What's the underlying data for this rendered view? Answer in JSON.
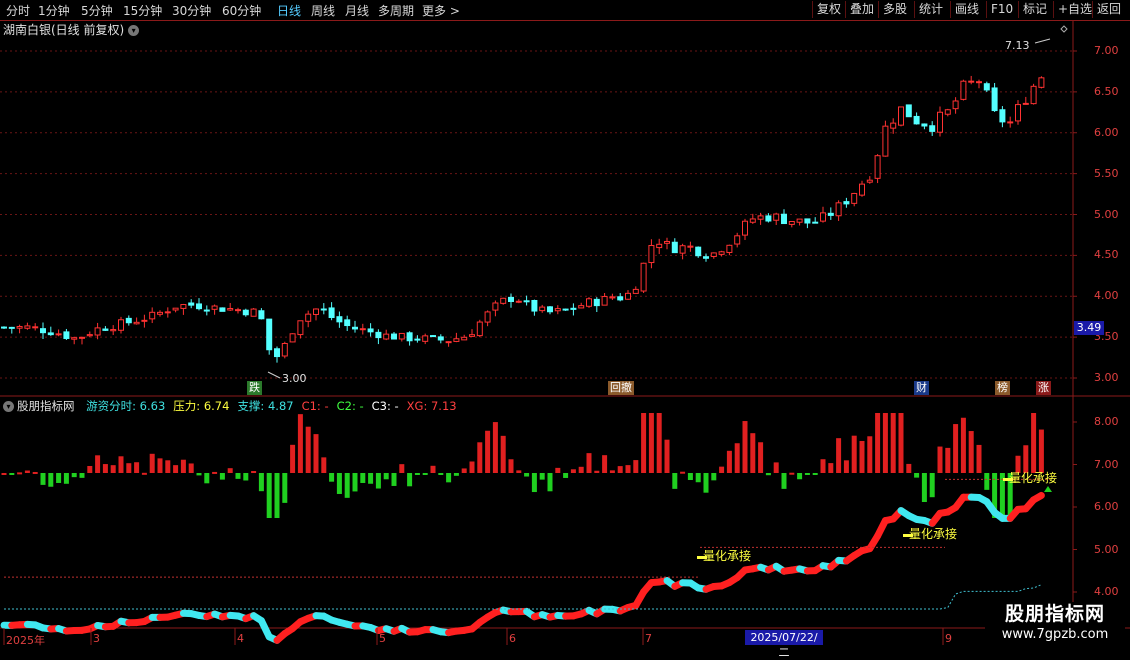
{
  "toolbar": {
    "periods": [
      "分时",
      "1分钟",
      "5分钟",
      "15分钟",
      "30分钟",
      "60分钟",
      "日线",
      "周线",
      "月线",
      "多周期",
      "更多 >"
    ],
    "active_period": "日线",
    "right_buttons": [
      "复权",
      "叠加",
      "多股",
      "统计",
      "画线",
      "F10",
      "标记",
      "+自选",
      "返回"
    ]
  },
  "stock": {
    "title": "湖南白银(日线 前复权)",
    "current_price_label": "3.49"
  },
  "main_chart": {
    "y_ticks": [
      "7.00",
      "6.50",
      "6.00",
      "5.50",
      "5.00",
      "4.50",
      "4.00",
      "3.50",
      "3.00"
    ],
    "high_label": "7.13",
    "low_label": "3.00",
    "tags": [
      {
        "text": "跌",
        "bg": "#2b7a2b",
        "color": "#ffffff"
      },
      {
        "text": "回撤",
        "bg": "#8b5a2b",
        "color": "#ffffff"
      },
      {
        "text": "财",
        "bg": "#1a3a8a",
        "color": "#ffffff"
      },
      {
        "text": "榜",
        "bg": "#8b5a2b",
        "color": "#ffffff"
      },
      {
        "text": "涨",
        "bg": "#8b1a1a",
        "color": "#ffffff"
      }
    ]
  },
  "indicator": {
    "name": "股朋指标网",
    "fields": [
      {
        "label": "游资分时:",
        "value": "6.63",
        "color": "#3fe0e0"
      },
      {
        "label": "压力:",
        "value": "6.74",
        "color": "#ffff40"
      },
      {
        "label": "支撑:",
        "value": "4.87",
        "color": "#3fe0e0"
      },
      {
        "label": "C1:",
        "value": "-",
        "color": "#ff4040"
      },
      {
        "label": "C2:",
        "value": "-",
        "color": "#40ff40"
      },
      {
        "label": "C3:",
        "value": "-",
        "color": "#ffffff"
      },
      {
        "label": "XG:",
        "value": "7.13",
        "color": "#ff4040"
      }
    ],
    "y_ticks": [
      "8.00",
      "7.00",
      "6.00",
      "5.00",
      "4.00"
    ],
    "annotation": "量化承接"
  },
  "dates": {
    "labels": [
      "2025年",
      "3",
      "4",
      "5",
      "6",
      "7",
      "9"
    ],
    "highlight": "2025/07/22/二"
  },
  "watermark": {
    "name": "股朋指标网",
    "url": "www.7gpzb.com"
  },
  "colors": {
    "up": "#ff3232",
    "down": "#54ffff",
    "axis": "#8b1a1a",
    "grid": "#6a1515"
  }
}
